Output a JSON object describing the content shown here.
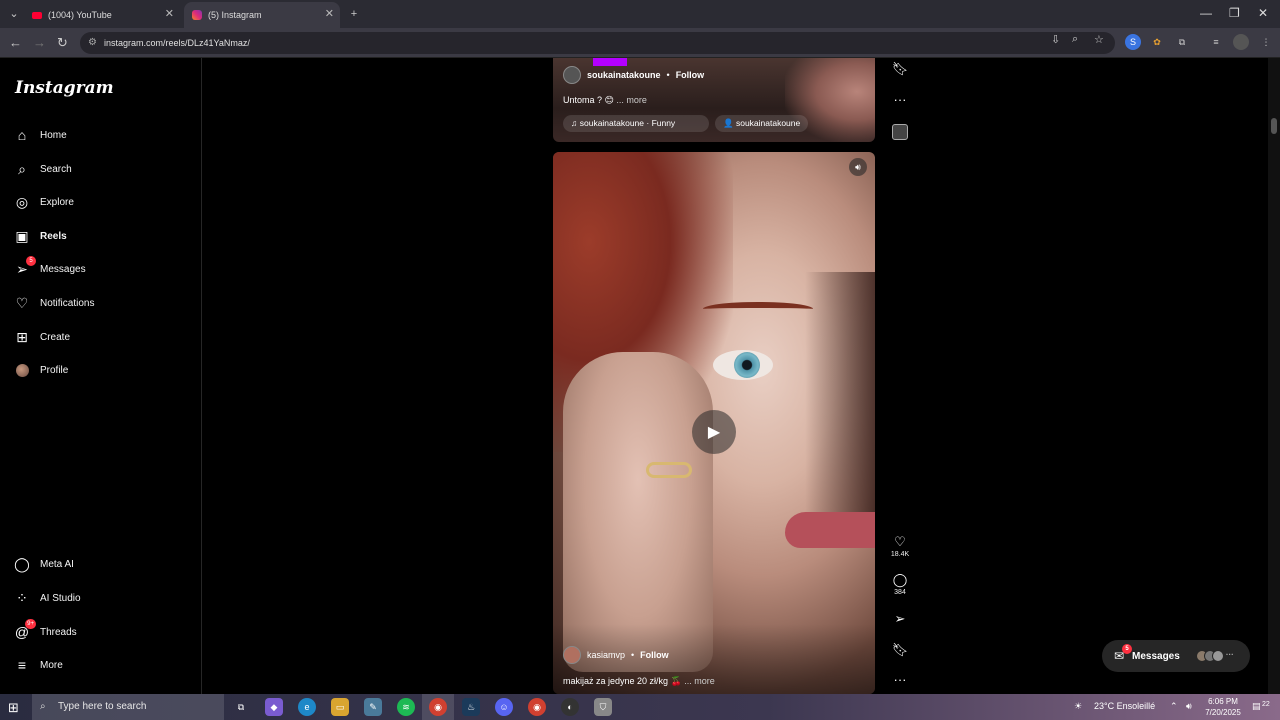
{
  "browser": {
    "tabs": [
      {
        "title": "(1004) YouTube",
        "favicon": "youtube-icon"
      },
      {
        "title": "(5) Instagram",
        "favicon": "instagram-icon"
      }
    ],
    "url": "instagram.com/reels/DLz41YaNmaz/"
  },
  "sidebar": {
    "logo": "Instagram",
    "items": [
      {
        "label": "Home",
        "icon": "home-icon"
      },
      {
        "label": "Search",
        "icon": "search-icon"
      },
      {
        "label": "Explore",
        "icon": "compass-icon"
      },
      {
        "label": "Reels",
        "icon": "reels-icon"
      },
      {
        "label": "Messages",
        "icon": "send-icon",
        "badge": "5"
      },
      {
        "label": "Notifications",
        "icon": "heart-icon"
      },
      {
        "label": "Create",
        "icon": "plus-square-icon"
      },
      {
        "label": "Profile",
        "icon": "avatar"
      }
    ],
    "bottom_items": [
      {
        "label": "Meta AI",
        "icon": "meta-ai-icon"
      },
      {
        "label": "AI Studio",
        "icon": "ai-studio-icon"
      },
      {
        "label": "Threads",
        "icon": "threads-icon",
        "badge": "9+"
      },
      {
        "label": "More",
        "icon": "menu-icon"
      }
    ]
  },
  "reel_top": {
    "username": "soukainatakoune",
    "follow": "Follow",
    "caption": "Untoma ? 😊",
    "more": "... more",
    "audio": "♫ soukainatakoune · Funny",
    "tagged": "soukainatakoune"
  },
  "reel_main": {
    "username": "kasiamvp",
    "follow": "Follow",
    "caption": "makijaż za jedyne 20 zł/kg 🍒",
    "more": "... more",
    "likes": "18.4K",
    "comments": "384"
  },
  "messages_pill": {
    "label": "Messages",
    "badge": "5"
  },
  "taskbar": {
    "search_placeholder": "Type here to search",
    "weather": "23°C  Ensoleillé",
    "time": "6:06 PM",
    "date": "7/20/2025",
    "notifications": "22"
  }
}
